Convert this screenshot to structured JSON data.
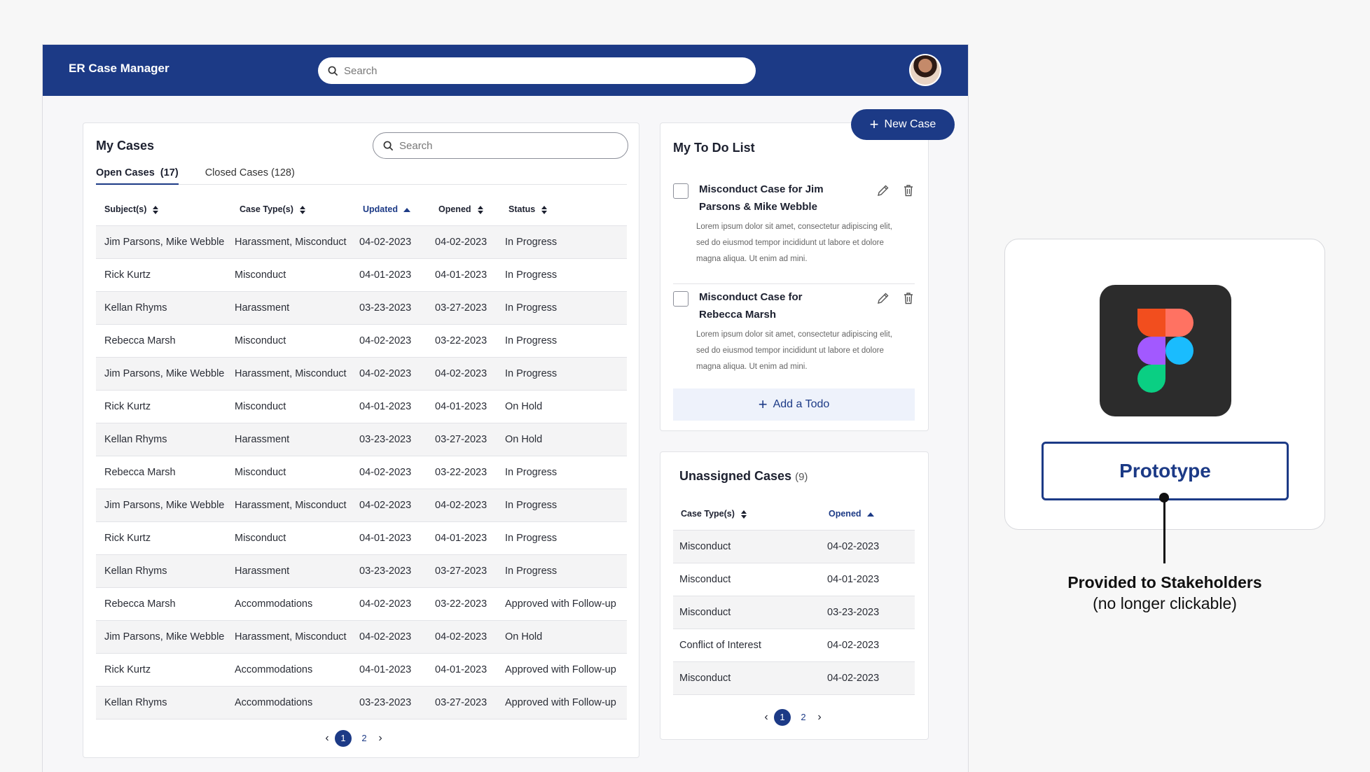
{
  "app": {
    "title": "ER Case Manager",
    "search_placeholder": "Search",
    "avatar_icon": "user-avatar"
  },
  "colors": {
    "primary": "#1c3a86",
    "row_shade": "#f4f4f5",
    "add_todo_bg": "#eef2fb"
  },
  "new_case": {
    "label": "New Case"
  },
  "cases": {
    "title": "My Cases",
    "search_placeholder": "Search",
    "tabs": [
      {
        "label": "Open Cases",
        "count": "(17)"
      },
      {
        "label": "Closed Cases (128)"
      }
    ],
    "columns": [
      "Subject(s)",
      "Case Type(s)",
      "Updated",
      "Opened",
      "Status"
    ],
    "rows": [
      [
        "Jim Parsons, Mike Webble",
        "Harassment, Misconduct",
        "04-02-2023",
        "04-02-2023",
        "In Progress"
      ],
      [
        "Rick Kurtz",
        "Misconduct",
        "04-01-2023",
        "04-01-2023",
        "In Progress"
      ],
      [
        "Kellan Rhyms",
        "Harassment",
        "03-23-2023",
        "03-27-2023",
        "In Progress"
      ],
      [
        "Rebecca Marsh",
        "Misconduct",
        "04-02-2023",
        "03-22-2023",
        "In Progress"
      ],
      [
        "Jim Parsons, Mike Webble",
        "Harassment, Misconduct",
        "04-02-2023",
        "04-02-2023",
        "In Progress"
      ],
      [
        "Rick Kurtz",
        "Misconduct",
        "04-01-2023",
        "04-01-2023",
        "On Hold"
      ],
      [
        "Kellan Rhyms",
        "Harassment",
        "03-23-2023",
        "03-27-2023",
        "On Hold"
      ],
      [
        "Rebecca Marsh",
        "Misconduct",
        "04-02-2023",
        "03-22-2023",
        "In Progress"
      ],
      [
        "Jim Parsons, Mike Webble",
        "Harassment, Misconduct",
        "04-02-2023",
        "04-02-2023",
        "In Progress"
      ],
      [
        "Rick Kurtz",
        "Misconduct",
        "04-01-2023",
        "04-01-2023",
        "In Progress"
      ],
      [
        "Kellan Rhyms",
        "Harassment",
        "03-23-2023",
        "03-27-2023",
        "In Progress"
      ],
      [
        "Rebecca Marsh",
        "Accommodations",
        "04-02-2023",
        "03-22-2023",
        "Approved with Follow-up"
      ],
      [
        "Jim Parsons, Mike Webble",
        "Harassment, Misconduct",
        "04-02-2023",
        "04-02-2023",
        "On Hold"
      ],
      [
        "Rick Kurtz",
        "Accommodations",
        "04-01-2023",
        "04-01-2023",
        "Approved with Follow-up"
      ],
      [
        "Kellan Rhyms",
        "Accommodations",
        "03-23-2023",
        "03-27-2023",
        "Approved with Follow-up"
      ]
    ],
    "pager": {
      "pages": [
        "1",
        "2"
      ],
      "current": "1"
    }
  },
  "todo": {
    "title": "My To Do List",
    "items": [
      {
        "title": "Misconduct Case for Jim Parsons & Mike Webble",
        "description": "Lorem ipsum dolor sit amet, consectetur adipiscing elit, sed do eiusmod tempor incididunt ut labore et dolore magna aliqua. Ut enim ad mini."
      },
      {
        "title": "Misconduct Case for Rebecca Marsh",
        "description": "Lorem ipsum dolor sit amet, consectetur adipiscing elit, sed do eiusmod tempor incididunt ut labore et dolore magna aliqua. Ut enim ad mini."
      }
    ],
    "add_label": "Add a Todo"
  },
  "unassigned": {
    "title": "Unassigned Cases",
    "count": "(9)",
    "columns": [
      "Case Type(s)",
      "Opened"
    ],
    "rows": [
      [
        "Misconduct",
        "04-02-2023"
      ],
      [
        "Misconduct",
        "04-01-2023"
      ],
      [
        "Misconduct",
        "03-23-2023"
      ],
      [
        "Conflict of Interest",
        "04-02-2023"
      ],
      [
        "Misconduct",
        "04-02-2023"
      ]
    ],
    "pager": {
      "pages": [
        "1",
        "2"
      ],
      "current": "1"
    }
  },
  "prototype": {
    "button_label": "Prototype",
    "caption_title": "Provided to Stakeholders",
    "caption_sub": "(no longer clickable)",
    "logo_icon": "figma-logo"
  }
}
